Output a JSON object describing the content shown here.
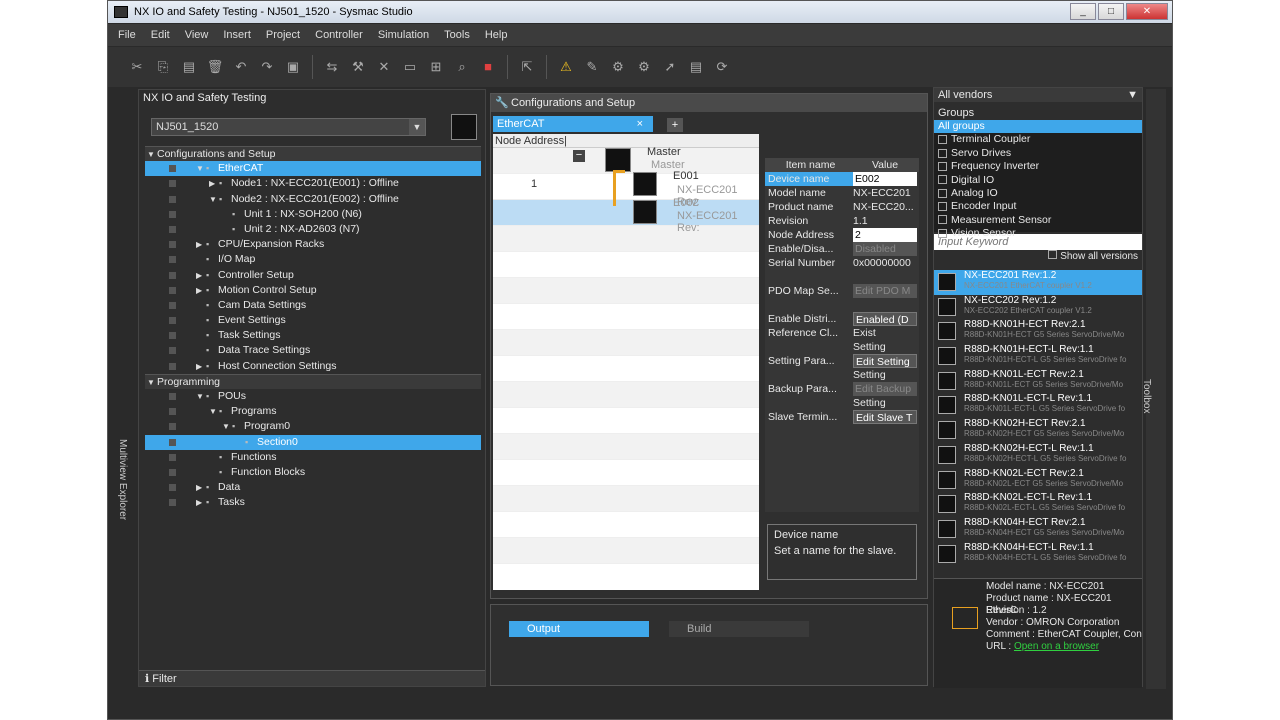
{
  "window": {
    "title": "NX IO and Safety Testing - NJ501_1520 - Sysmac Studio"
  },
  "menu": [
    "File",
    "Edit",
    "View",
    "Insert",
    "Project",
    "Controller",
    "Simulation",
    "Tools",
    "Help"
  ],
  "left": {
    "title": "NX IO and Safety Testing",
    "controller": "NJ501_1520",
    "strip_label": "Multiview Explorer",
    "filter": "Filter",
    "tree": [
      {
        "label": "Configurations and Setup",
        "level": 0,
        "hdr": true,
        "tw": "▼"
      },
      {
        "label": "EtherCAT",
        "level": 1,
        "sel": true,
        "tw": "▼"
      },
      {
        "label": "Node1 : NX-ECC201(E001) : Offline",
        "level": 2,
        "tw": "▶"
      },
      {
        "label": "Node2 : NX-ECC201(E002) : Offline",
        "level": 2,
        "tw": "▼"
      },
      {
        "label": "Unit 1 : NX-SOH200 (N6)",
        "level": 3,
        "tw": ""
      },
      {
        "label": "Unit 2 : NX-AD2603 (N7)",
        "level": 3,
        "tw": ""
      },
      {
        "label": "CPU/Expansion Racks",
        "level": 1,
        "tw": "▶"
      },
      {
        "label": "I/O Map",
        "level": 1,
        "tw": ""
      },
      {
        "label": "Controller Setup",
        "level": 1,
        "tw": "▶"
      },
      {
        "label": "Motion Control Setup",
        "level": 1,
        "tw": "▶"
      },
      {
        "label": "Cam Data Settings",
        "level": 1,
        "tw": ""
      },
      {
        "label": "Event Settings",
        "level": 1,
        "tw": ""
      },
      {
        "label": "Task Settings",
        "level": 1,
        "tw": ""
      },
      {
        "label": "Data Trace Settings",
        "level": 1,
        "tw": ""
      },
      {
        "label": "Host Connection Settings",
        "level": 1,
        "tw": "▶"
      },
      {
        "label": "Programming",
        "level": 0,
        "hdr": true,
        "tw": "▼"
      },
      {
        "label": "POUs",
        "level": 1,
        "tw": "▼"
      },
      {
        "label": "Programs",
        "level": 2,
        "tw": "▼"
      },
      {
        "label": "Program0",
        "level": 3,
        "tw": "▼"
      },
      {
        "label": "Section0",
        "level": 4,
        "sel": true,
        "tw": ""
      },
      {
        "label": "Functions",
        "level": 2,
        "tw": ""
      },
      {
        "label": "Function Blocks",
        "level": 2,
        "tw": ""
      },
      {
        "label": "Data",
        "level": 1,
        "tw": "▶"
      },
      {
        "label": "Tasks",
        "level": 1,
        "tw": "▶"
      }
    ]
  },
  "config": {
    "title": "Configurations and Setup",
    "tab": "EtherCAT",
    "node_address_header": "Node Address|",
    "master": "Master",
    "node1_addr": "1",
    "node1_id": "E001",
    "node2_id": "E002",
    "node_model": "NX-ECC201 Rev:",
    "props_header": {
      "item": "Item name",
      "value": "Value"
    },
    "props": [
      {
        "k": "Device name",
        "v": "E002",
        "style": "box",
        "sel": true
      },
      {
        "k": "Model name",
        "v": "NX-ECC201",
        "style": ""
      },
      {
        "k": "Product name",
        "v": "NX-ECC20...",
        "style": ""
      },
      {
        "k": "Revision",
        "v": "1.1",
        "style": ""
      },
      {
        "k": "Node Address",
        "v": "2",
        "style": "box"
      },
      {
        "k": "Enable/Disa...",
        "v": "Disabled",
        "style": "dis"
      },
      {
        "k": "Serial Number",
        "v": "0x00000000",
        "style": ""
      },
      {
        "k": "",
        "v": "",
        "style": ""
      },
      {
        "k": "PDO Map Se...",
        "v": "Edit PDO M",
        "style": "dis"
      },
      {
        "k": "",
        "v": "",
        "style": ""
      },
      {
        "k": "Enable Distri...",
        "v": "Enabled (D",
        "style": "btn"
      },
      {
        "k": "Reference Cl...",
        "v": "Exist",
        "style": ""
      },
      {
        "k": "",
        "v": "Setting",
        "style": ""
      },
      {
        "k": "Setting Para...",
        "v": "Edit Setting",
        "style": "btn"
      },
      {
        "k": "",
        "v": "Setting",
        "style": ""
      },
      {
        "k": "Backup Para...",
        "v": "Edit Backup",
        "style": "dis"
      },
      {
        "k": "",
        "v": "Setting",
        "style": ""
      },
      {
        "k": "Slave Termin...",
        "v": "Edit Slave T",
        "style": "btn"
      }
    ],
    "help_title": "Device name",
    "help_text": "Set a name for the slave."
  },
  "output": {
    "tabs": [
      "Output",
      "Build"
    ]
  },
  "right": {
    "vendor": "All vendors",
    "groups_label": "Groups",
    "strip_label": "Toolbox",
    "groups": [
      "All groups",
      "Terminal Coupler",
      "Servo Drives",
      "Frequency Inverter",
      "Digital IO",
      "Analog IO",
      "Encoder Input",
      "Measurement Sensor",
      "Vision Sensor"
    ],
    "keyword_placeholder": "Input Keyword",
    "show_all": "Show all versions",
    "devices": [
      {
        "n": "NX-ECC201 Rev:1.2",
        "d": "NX-ECC201 EtherCAT coupler V1.2"
      },
      {
        "n": "NX-ECC202 Rev:1.2",
        "d": "NX-ECC202 EtherCAT coupler V1.2"
      },
      {
        "n": "R88D-KN01H-ECT Rev:2.1",
        "d": "R88D-KN01H-ECT G5 Series ServoDrive/Mo"
      },
      {
        "n": "R88D-KN01H-ECT-L Rev:1.1",
        "d": "R88D-KN01H-ECT-L G5 Series ServoDrive fo"
      },
      {
        "n": "R88D-KN01L-ECT Rev:2.1",
        "d": "R88D-KN01L-ECT G5 Series ServoDrive/Mo"
      },
      {
        "n": "R88D-KN01L-ECT-L Rev:1.1",
        "d": "R88D-KN01L-ECT-L G5 Series ServoDrive fo"
      },
      {
        "n": "R88D-KN02H-ECT Rev:2.1",
        "d": "R88D-KN02H-ECT G5 Series ServoDrive/Mo"
      },
      {
        "n": "R88D-KN02H-ECT-L Rev:1.1",
        "d": "R88D-KN02H-ECT-L G5 Series ServoDrive fo"
      },
      {
        "n": "R88D-KN02L-ECT Rev:2.1",
        "d": "R88D-KN02L-ECT G5 Series ServoDrive/Mo"
      },
      {
        "n": "R88D-KN02L-ECT-L Rev:1.1",
        "d": "R88D-KN02L-ECT-L G5 Series ServoDrive fo"
      },
      {
        "n": "R88D-KN04H-ECT Rev:2.1",
        "d": "R88D-KN04H-ECT G5 Series ServoDrive/Mo"
      },
      {
        "n": "R88D-KN04H-ECT-L Rev:1.1",
        "d": "R88D-KN04H-ECT-L G5 Series ServoDrive fo"
      }
    ],
    "info": {
      "model": "Model name : NX-ECC201",
      "product": "Product name : NX-ECC201 EtherC",
      "revision": "Revision : 1.2",
      "vendor": "Vendor : OMRON Corporation",
      "comment": "Comment : EtherCAT Coupler, Con",
      "url_label": "URL : ",
      "url_link": "Open on a browser"
    }
  }
}
